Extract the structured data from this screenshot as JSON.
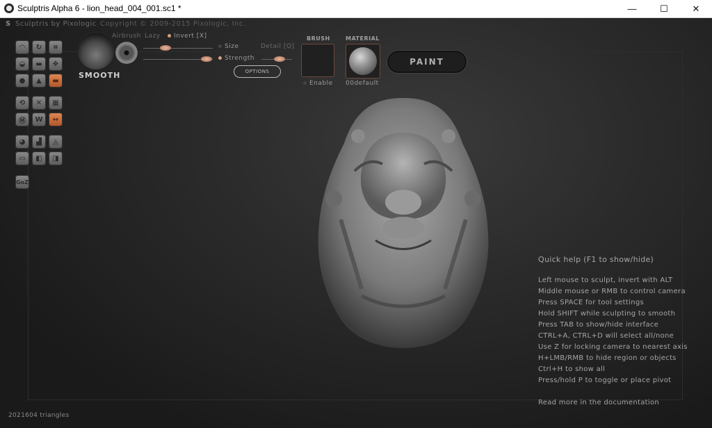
{
  "window": {
    "title": "Sculptris Alpha 6 - lion_head_004_001.sc1 *",
    "minimize_glyph": "—",
    "maximize_glyph": "☐",
    "close_glyph": "✕"
  },
  "header": {
    "brand": "Sculptris by Pixologic",
    "copyright": "Copyright © 2009-2015 Pixologic, Inc."
  },
  "tools": {
    "goz_label": "GoZ",
    "active_color": "#d9743f"
  },
  "brush": {
    "name": "SMOOTH",
    "airbrush_label": "Airbrush",
    "lazy_label": "Lazy",
    "invert_label": "Invert [X]",
    "size_label": "Size",
    "strength_label": "Strength",
    "detail_label": "Detail [Q]",
    "options_label": "OPTIONS"
  },
  "brush_box": {
    "title": "BRUSH",
    "enable_label": "Enable"
  },
  "material": {
    "title": "MATERIAL",
    "name": "00default"
  },
  "paint_button": {
    "label": "PAINT"
  },
  "quick_help": {
    "title": "Quick help (F1 to show/hide)",
    "lines": [
      "Left mouse to sculpt, invert with ALT",
      "Middle mouse or RMB to control camera",
      "Press SPACE for tool settings",
      "Hold SHIFT while sculpting to smooth",
      "Press TAB to show/hide interface",
      "CTRL+A, CTRL+D will select all/none",
      "Use Z for locking camera to nearest axis",
      "H+LMB/RMB to hide region or objects",
      "Ctrl+H to show all",
      "Press/hold P to toggle or place pivot"
    ],
    "footer": "Read more in the documentation"
  },
  "status": {
    "triangles": "2021604 triangles"
  }
}
